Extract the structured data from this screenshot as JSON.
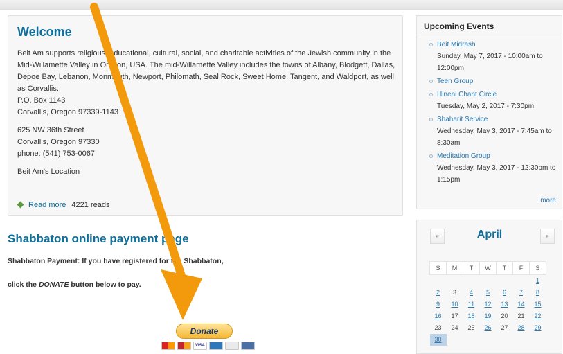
{
  "welcome": {
    "title": "Welcome",
    "paragraph": "Beit Am supports religious, educational, cultural, social, and charitable activities of the Jewish community in the Mid-Willamette Valley in Oregon, USA. The mid-Willamette Valley includes the towns of Albany, Blodgett, Dallas, Depoe Bay, Lebanon, Monmouth, Newport, Philomath, Seal Rock, Sweet Home, Tangent, and Waldport, as well as Corvallis.",
    "po_box": "P.O. Box 1143",
    "po_city": "Corvallis, Oregon 97339-1143",
    "street": "625 NW 36th Street",
    "street_city": "Corvallis, Oregon 97330",
    "phone": "phone: (541) 753-0067",
    "location_link": "Beit Am's Location",
    "read_more": "Read more",
    "reads": "4221 reads"
  },
  "shabbaton": {
    "title": "Shabbaton online payment page",
    "line1": "Shabbaton Payment: If you have registered for the Shabbaton,",
    "line2_pre": "click the ",
    "line2_em": "DONATE",
    "line2_post": " button below to pay.",
    "donate_label": "Donate"
  },
  "events": {
    "title": "Upcoming Events",
    "items": [
      {
        "name": "Beit Midrash",
        "when": "Sunday, May 7, 2017 - 10:00am to 12:00pm"
      },
      {
        "name": "Teen Group",
        "when": ""
      },
      {
        "name": "Hineni Chant Circle",
        "when": "Tuesday, May 2, 2017 - 7:30pm"
      },
      {
        "name": "Shaharit Service",
        "when": "Wednesday, May 3, 2017 - 7:45am to 8:30am"
      },
      {
        "name": "Meditation Group",
        "when": "Wednesday, May 3, 2017 - 12:30pm to 1:15pm"
      }
    ],
    "more": "more"
  },
  "calendar": {
    "month": "April",
    "prev": "«",
    "next": "»",
    "days": [
      "S",
      "M",
      "T",
      "W",
      "T",
      "F",
      "S"
    ],
    "weeks": [
      [
        "",
        "",
        "",
        "",
        "",
        "",
        "1"
      ],
      [
        "2",
        "3",
        "4",
        "5",
        "6",
        "7",
        "8"
      ],
      [
        "9",
        "10",
        "11",
        "12",
        "13",
        "14",
        "15"
      ],
      [
        "16",
        "17",
        "18",
        "19",
        "20",
        "21",
        "22"
      ],
      [
        "23",
        "24",
        "25",
        "26",
        "27",
        "28",
        "29"
      ],
      [
        "30",
        "",
        "",
        "",
        "",
        "",
        ""
      ]
    ],
    "linked_days": [
      "1",
      "2",
      "4",
      "5",
      "6",
      "7",
      "8",
      "9",
      "10",
      "11",
      "12",
      "13",
      "14",
      "15",
      "16",
      "18",
      "19",
      "22",
      "26",
      "28",
      "29",
      "30"
    ],
    "today": "30"
  },
  "colors": {
    "accent_blue": "#0f6f9c",
    "link_blue": "#2a7ab0",
    "annotation_arrow": "#f39a0c"
  }
}
